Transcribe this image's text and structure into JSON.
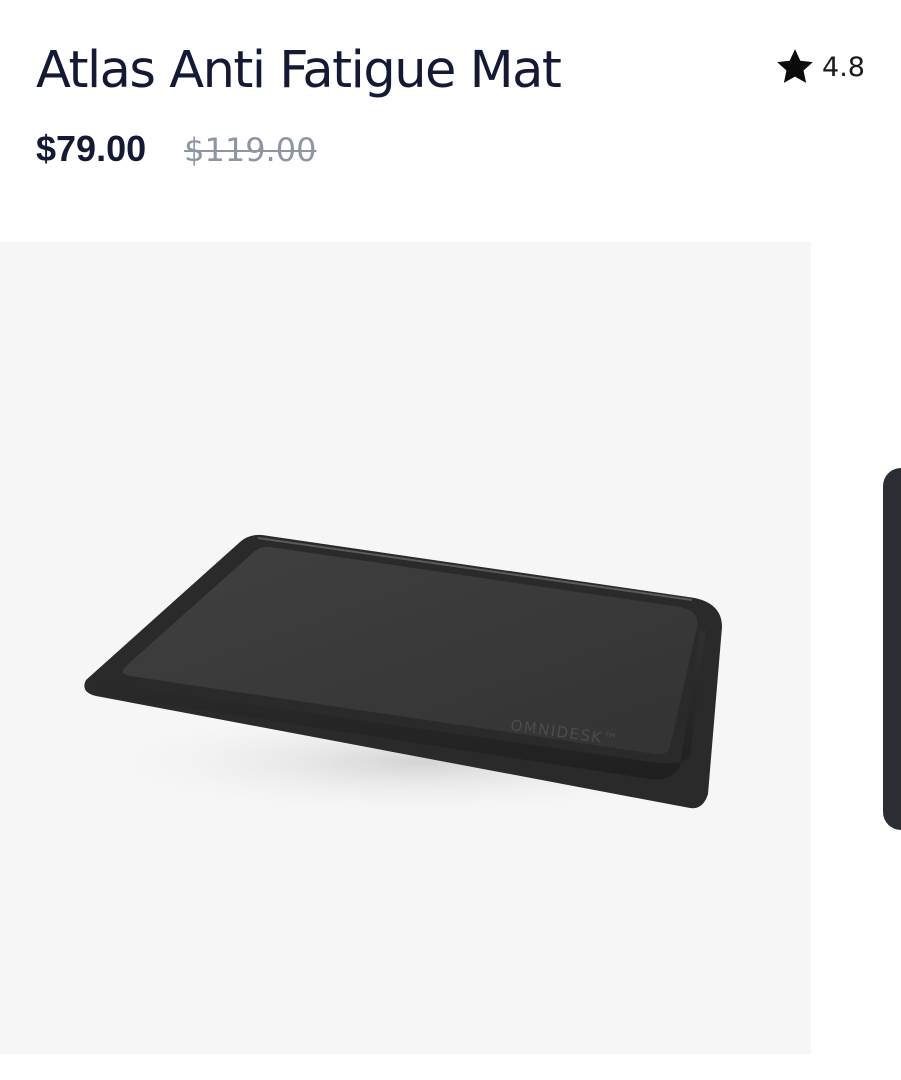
{
  "product": {
    "title": "Atlas Anti Fatigue Mat",
    "rating": "4.8",
    "price_current": "$79.00",
    "price_original": "$119.00"
  },
  "gallery": {
    "brand_mark": "OMNIDESK™"
  },
  "colors": {
    "title_text": "#141a35",
    "strikethrough_price": "#8e95a3",
    "gallery_background": "#f6f6f6",
    "mat": "#3a3a3a"
  },
  "icons": {
    "rating": "star-icon"
  }
}
